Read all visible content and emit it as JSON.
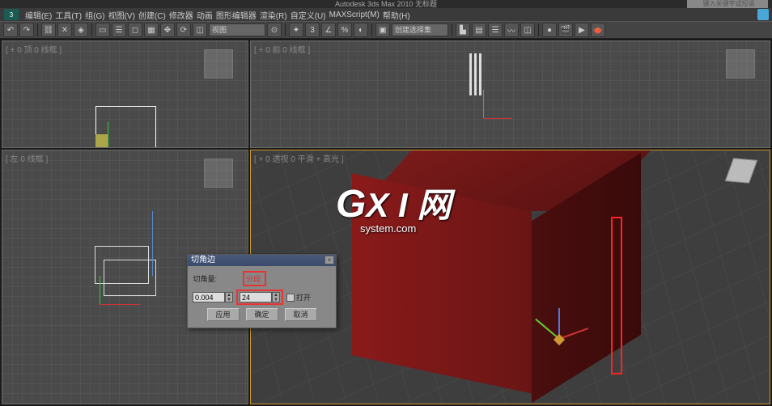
{
  "app": {
    "title": "Autodesk 3ds Max 2010  无标题",
    "search_placeholder": "键入关键字或短语"
  },
  "menu": {
    "items": [
      "编辑(E)",
      "工具(T)",
      "组(G)",
      "视图(V)",
      "创建(C)",
      "修改器",
      "动画",
      "图形编辑器",
      "渲染(R)",
      "自定义(U)",
      "MAXScript(M)",
      "帮助(H)"
    ]
  },
  "toolbar": {
    "dropdown1": "视图",
    "dropdown2": "创建选择集"
  },
  "viewports": {
    "top_left": "[ + 0 顶 0 线框 ]",
    "top_right": "[ + 0 前 0 线框 ]",
    "bottom_left": "[ 左 0 线框 ]",
    "perspective": "[ + 0 透视 0 平滑 + 高光 ]"
  },
  "dialog": {
    "title": "切角边",
    "label_amount": "切角量:",
    "label_segments": "分段:",
    "value_amount": "0.004",
    "value_segments": "24",
    "check_open": "打开",
    "btn_apply": "应用",
    "btn_ok": "确定",
    "btn_cancel": "取消"
  },
  "watermark": {
    "line1_g": "G",
    "line1_rest": "X I 网",
    "line2": "system.com"
  }
}
